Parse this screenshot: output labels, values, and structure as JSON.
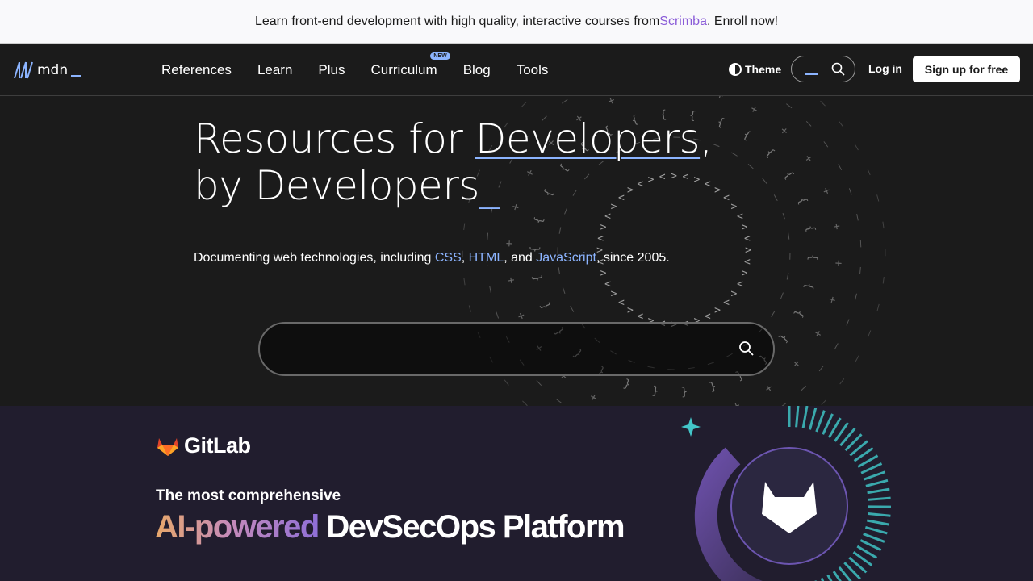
{
  "banner": {
    "text_before": "Learn front-end development with high quality, interactive courses from ",
    "link": "Scrimba",
    "text_after": ". Enroll now!"
  },
  "header": {
    "logo_text": "mdn",
    "nav": [
      {
        "label": "References"
      },
      {
        "label": "Learn"
      },
      {
        "label": "Plus"
      },
      {
        "label": "Curriculum",
        "badge": "NEW"
      },
      {
        "label": "Blog"
      },
      {
        "label": "Tools"
      }
    ],
    "theme_label": "Theme",
    "login_label": "Log in",
    "signup_label": "Sign up for free"
  },
  "hero": {
    "headline_line1_pre": "Resources for ",
    "headline_line1_link": "Developers",
    "headline_line1_post": ",",
    "headline_line2": "by Developers",
    "headline_cursor": "_",
    "tagline_pre": "Documenting web technologies, including ",
    "tagline_css": "CSS",
    "tagline_sep1": ", ",
    "tagline_html": "HTML",
    "tagline_sep2": ", and ",
    "tagline_js": "JavaScript",
    "tagline_post": ", since 2005."
  },
  "ad": {
    "brand": "GitLab",
    "subtitle": "The most comprehensive",
    "title_gradient": "AI-powered",
    "title_rest": " DevSecOps Platform"
  },
  "colors": {
    "accent": "#8cb4ff",
    "scrimba": "#8a5cd8",
    "ad_bg": "#211d2e"
  }
}
